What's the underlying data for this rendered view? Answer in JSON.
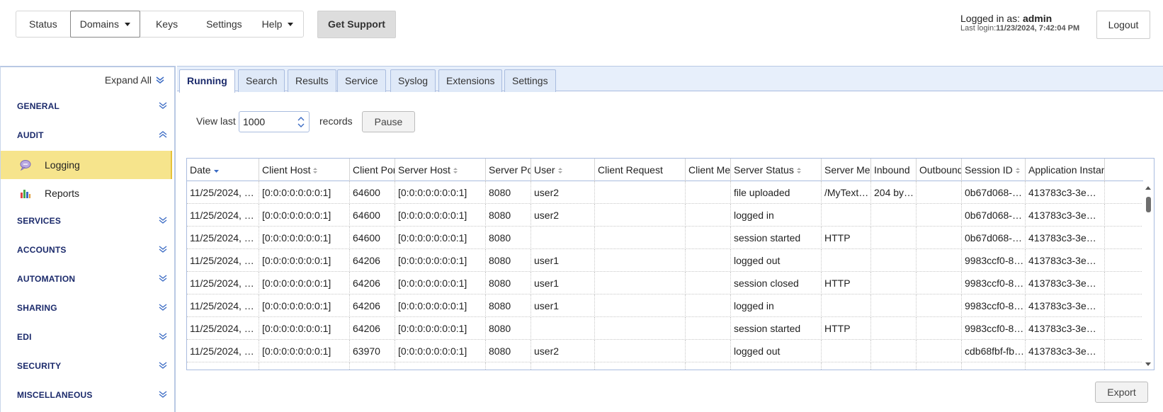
{
  "topnav": {
    "items": [
      {
        "label": "Status"
      },
      {
        "label": "Domains"
      },
      {
        "label": "Keys"
      },
      {
        "label": "Settings"
      },
      {
        "label": "Help"
      }
    ],
    "support_label": "Get Support"
  },
  "login": {
    "prefix": "Logged in as: ",
    "user": "admin",
    "last_login_prefix": "Last login:",
    "last_login_value": "11/23/2024, 7:42:04 PM",
    "logout_label": "Logout"
  },
  "sidebar": {
    "expand_all": "Expand All",
    "sections": [
      {
        "label": "GENERAL",
        "expanded": false
      },
      {
        "label": "AUDIT",
        "expanded": true
      },
      {
        "label": "SERVICES",
        "expanded": false
      },
      {
        "label": "ACCOUNTS",
        "expanded": false
      },
      {
        "label": "AUTOMATION",
        "expanded": false
      },
      {
        "label": "SHARING",
        "expanded": false
      },
      {
        "label": "EDI",
        "expanded": false
      },
      {
        "label": "SECURITY",
        "expanded": false
      },
      {
        "label": "MISCELLANEOUS",
        "expanded": false
      }
    ],
    "audit_items": [
      {
        "label": "Logging",
        "icon": "speech-bubble-icon",
        "active": true
      },
      {
        "label": "Reports",
        "icon": "bar-chart-icon",
        "active": false
      }
    ]
  },
  "tabs": [
    {
      "label": "Running",
      "active": true
    },
    {
      "label": "Search"
    },
    {
      "label": "Results"
    },
    {
      "label": "Service"
    },
    {
      "label": "Syslog"
    },
    {
      "label": "Extensions"
    },
    {
      "label": "Settings"
    }
  ],
  "controls": {
    "view_last_label": "View last",
    "view_last_value": "1000",
    "records_label": "records",
    "pause_label": "Pause",
    "export_label": "Export"
  },
  "grid": {
    "columns": [
      {
        "label": "Date",
        "sort": "desc"
      },
      {
        "label": "Client Host",
        "sort": "none"
      },
      {
        "label": "Client Port",
        "sort": null
      },
      {
        "label": "Server Host",
        "sort": "none"
      },
      {
        "label": "Server Port",
        "sort": null
      },
      {
        "label": "User",
        "sort": "none"
      },
      {
        "label": "Client Request",
        "sort": null
      },
      {
        "label": "Client Message",
        "sort": null
      },
      {
        "label": "Server Status",
        "sort": "none"
      },
      {
        "label": "Server Message",
        "sort": null
      },
      {
        "label": "Inbound",
        "sort": null
      },
      {
        "label": "Outbound",
        "sort": null
      },
      {
        "label": "Session ID",
        "sort": "none"
      },
      {
        "label": "Application Instance",
        "sort": null
      }
    ],
    "rows": [
      [
        "11/25/2024, …",
        "[0:0:0:0:0:0:0:1]",
        "64600",
        "[0:0:0:0:0:0:0:1]",
        "8080",
        "user2",
        "",
        "",
        "file uploaded",
        "/MyText…",
        "204 by…",
        "",
        "0b67d068-…",
        "413783c3-3e…"
      ],
      [
        "11/25/2024, …",
        "[0:0:0:0:0:0:0:1]",
        "64600",
        "[0:0:0:0:0:0:0:1]",
        "8080",
        "user2",
        "",
        "",
        "logged in",
        "",
        "",
        "",
        "0b67d068-…",
        "413783c3-3e…"
      ],
      [
        "11/25/2024, …",
        "[0:0:0:0:0:0:0:1]",
        "64600",
        "[0:0:0:0:0:0:0:1]",
        "8080",
        "",
        "",
        "",
        "session started",
        "HTTP",
        "",
        "",
        "0b67d068-…",
        "413783c3-3e…"
      ],
      [
        "11/25/2024, …",
        "[0:0:0:0:0:0:0:1]",
        "64206",
        "[0:0:0:0:0:0:0:1]",
        "8080",
        "user1",
        "",
        "",
        "logged out",
        "",
        "",
        "",
        "9983ccf0-8…",
        "413783c3-3e…"
      ],
      [
        "11/25/2024, …",
        "[0:0:0:0:0:0:0:1]",
        "64206",
        "[0:0:0:0:0:0:0:1]",
        "8080",
        "user1",
        "",
        "",
        "session closed",
        "HTTP",
        "",
        "",
        "9983ccf0-8…",
        "413783c3-3e…"
      ],
      [
        "11/25/2024, …",
        "[0:0:0:0:0:0:0:1]",
        "64206",
        "[0:0:0:0:0:0:0:1]",
        "8080",
        "user1",
        "",
        "",
        "logged in",
        "",
        "",
        "",
        "9983ccf0-8…",
        "413783c3-3e…"
      ],
      [
        "11/25/2024, …",
        "[0:0:0:0:0:0:0:1]",
        "64206",
        "[0:0:0:0:0:0:0:1]",
        "8080",
        "",
        "",
        "",
        "session started",
        "HTTP",
        "",
        "",
        "9983ccf0-8…",
        "413783c3-3e…"
      ],
      [
        "11/25/2024, …",
        "[0:0:0:0:0:0:0:1]",
        "63970",
        "[0:0:0:0:0:0:0:1]",
        "8080",
        "user2",
        "",
        "",
        "logged out",
        "",
        "",
        "",
        "cdb68fbf-fb…",
        "413783c3-3e…"
      ]
    ]
  },
  "colors": {
    "active_item_bg": "#f6e48c",
    "tabbar_bg": "#e7effb",
    "section_text": "#1b2a6b",
    "border_blue": "#a9bcdf"
  }
}
